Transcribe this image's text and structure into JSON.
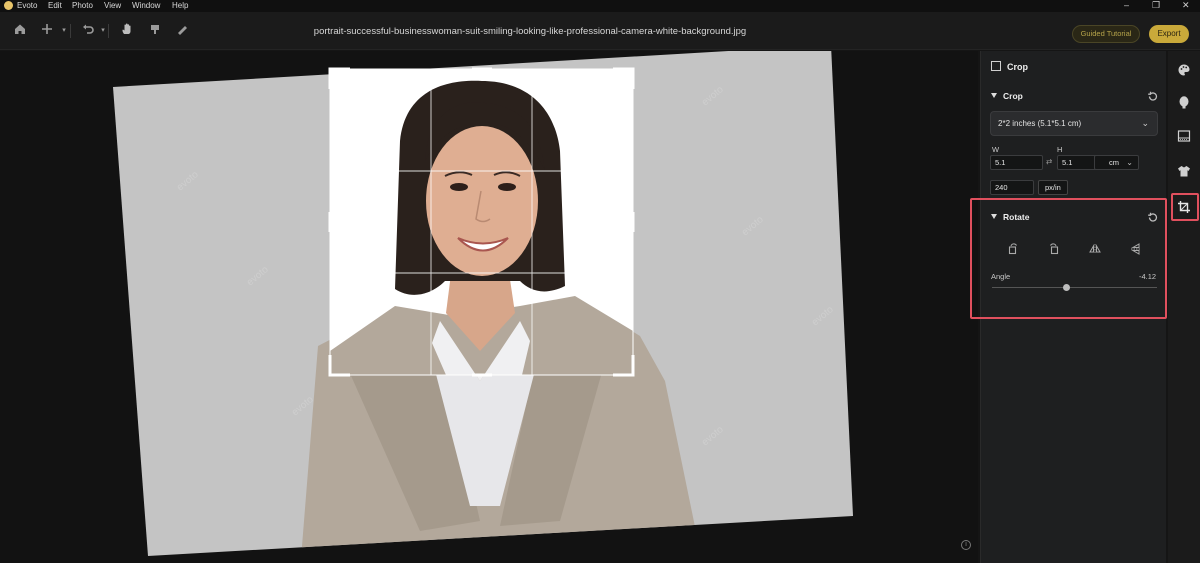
{
  "menubar": {
    "items": [
      "Evoto",
      "Edit",
      "Photo",
      "View",
      "Window",
      "Help"
    ],
    "window_controls": [
      "–",
      "❐",
      "✕"
    ]
  },
  "toolbar": {
    "file_title": "portrait-successful-businesswoman-suit-smiling-looking-like-professional-camera-white-background.jpg",
    "guided_label": "Guided Tutorial",
    "export_label": "Export",
    "icons": [
      "home-icon",
      "add-icon",
      "undo-icon",
      "hand-icon",
      "brush-icon",
      "eraser-icon"
    ]
  },
  "panel": {
    "title": "Crop",
    "crop_section": {
      "title": "Crop",
      "preset": "2*2 inches (5.1*5.1 cm)",
      "w_label": "W",
      "h_label": "H",
      "w_value": "5.1",
      "h_value": "5.1",
      "unit": "cm",
      "resolution": "240",
      "resolution_unit": "px/in"
    },
    "rotate_section": {
      "title": "Rotate",
      "angle_label": "Angle",
      "angle_value": "-4.12",
      "angle_min": -45,
      "angle_max": 45
    }
  },
  "rail": {
    "icons": [
      "palette-icon",
      "face-icon",
      "background-icon",
      "clothing-icon",
      "crop-icon"
    ],
    "active": "crop-icon"
  },
  "colors": {
    "accent_gold": "#c9a93a",
    "highlight_red": "#e0505e",
    "panel_bg": "#1e1f20"
  }
}
